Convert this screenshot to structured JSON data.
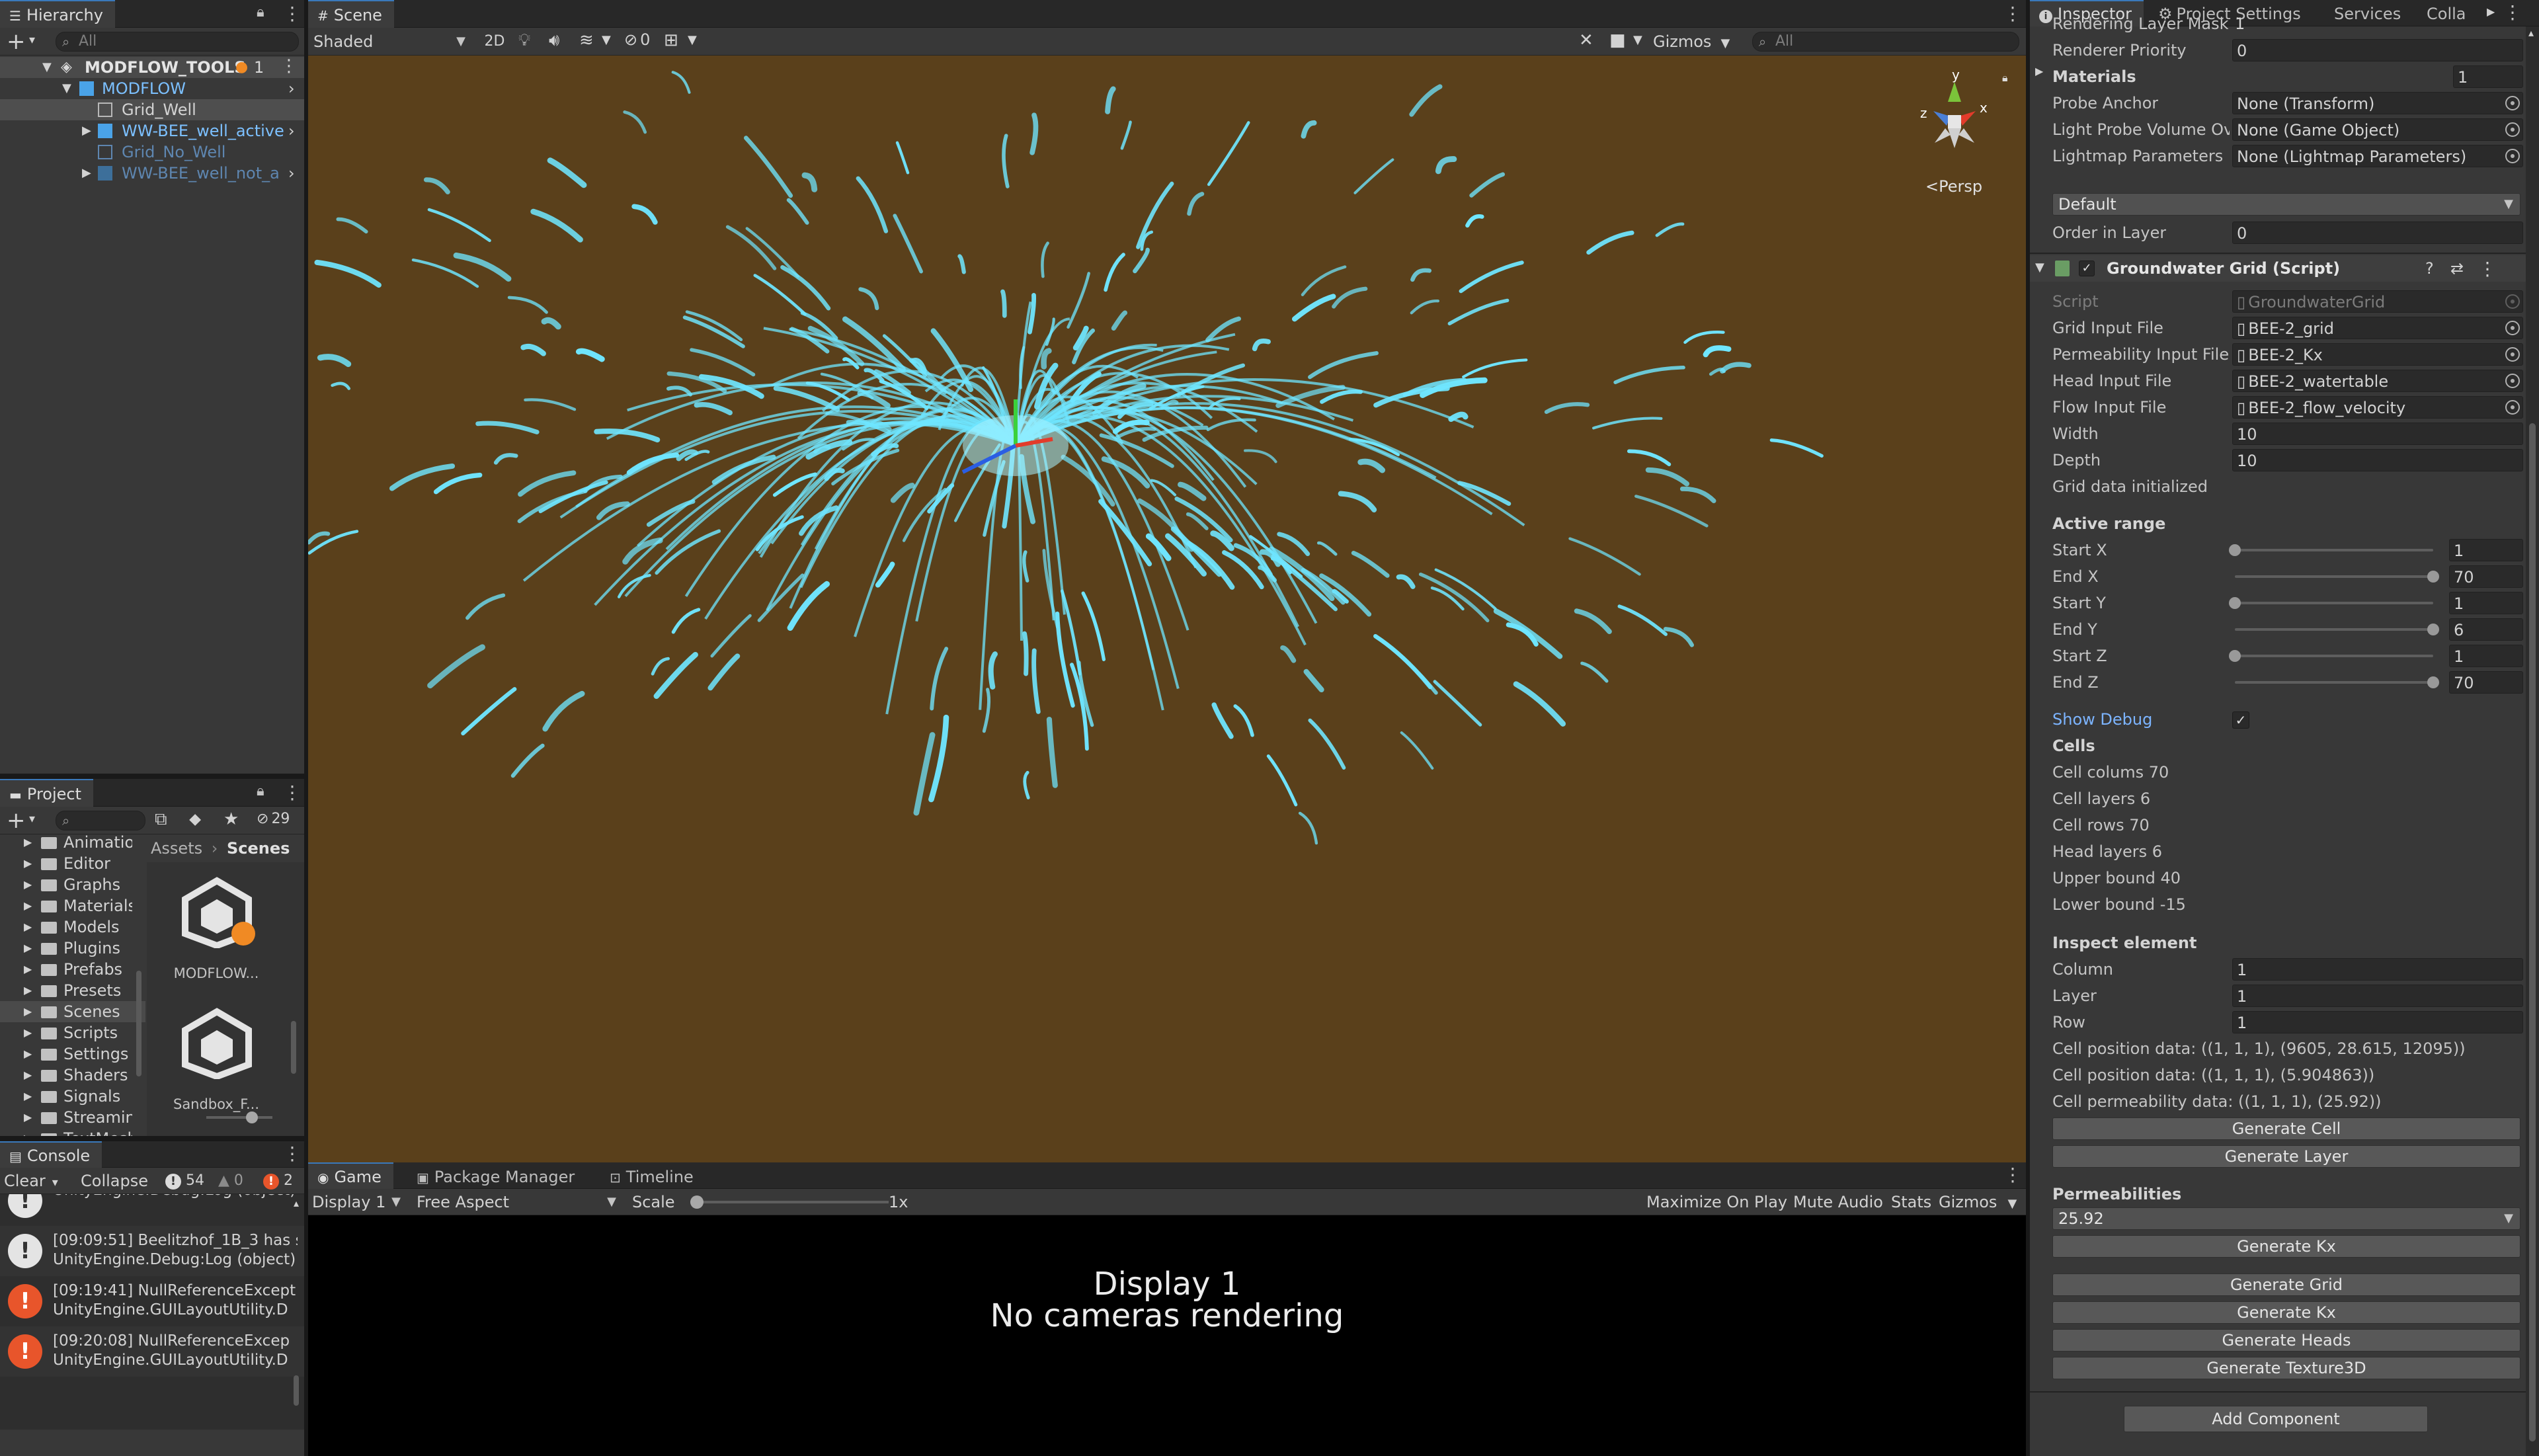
{
  "hierarchy": {
    "tab": "Hierarchy",
    "search_placeholder": "All",
    "scene": "MODFLOW_TOOLS",
    "scene_badge": "1",
    "items": [
      {
        "label": "MODFLOW",
        "color": "#7cc0ff"
      },
      {
        "label": "Grid_Well",
        "color": "#d2d2d2"
      },
      {
        "label": "WW-BEE_well_active",
        "color": "#7cc0ff"
      },
      {
        "label": "Grid_No_Well",
        "color": "#5e86b0"
      },
      {
        "label": "WW-BEE_well_not_active",
        "color": "#5e86b0"
      }
    ]
  },
  "scene": {
    "tab": "Scene",
    "shading": "Shaded",
    "btn_2d": "2D",
    "hidden_count": "0",
    "gizmos": "Gizmos",
    "search_placeholder": "All",
    "persp": "Persp",
    "axis_y": "y",
    "axis_x": "x",
    "axis_z": "z"
  },
  "project": {
    "tab": "Project",
    "count": "29",
    "breadcrumb": [
      "Assets",
      "Scenes"
    ],
    "folders": [
      "Animations",
      "Editor",
      "Graphs",
      "Materials",
      "Models",
      "Plugins",
      "Prefabs",
      "Presets",
      "Scenes",
      "Scripts",
      "Settings",
      "Shaders",
      "Signals",
      "StreamingAssets",
      "TextMeshPro"
    ],
    "assets": [
      {
        "label": "MODFLOW..."
      },
      {
        "label": "Sandbox_F..."
      }
    ]
  },
  "console": {
    "tab": "Console",
    "clear": "Clear",
    "collapse": "Collapse",
    "log_count": "54",
    "warn_count": "0",
    "err_count": "2",
    "rows": [
      {
        "line1": "",
        "line2": "UnityEngine.Debug:Log (object)",
        "type": "log"
      },
      {
        "line1": "[09:09:51] Beelitzhof_1B_3 has s",
        "line2": "UnityEngine.Debug:Log (object)",
        "type": "log"
      },
      {
        "line1": "[09:19:41] NullReferenceExcept",
        "line2": "UnityEngine.GUILayoutUtility.D",
        "type": "error"
      },
      {
        "line1": "[09:20:08] NullReferenceExcep",
        "line2": "UnityEngine.GUILayoutUtility.D",
        "type": "error"
      }
    ]
  },
  "game": {
    "tabs": [
      "Game",
      "Package Manager",
      "Timeline"
    ],
    "display": "Display 1",
    "aspect": "Free Aspect",
    "scale_label": "Scale",
    "scale_value": "1x",
    "toggles": [
      "Maximize On Play",
      "Mute Audio",
      "Stats",
      "Gizmos"
    ],
    "message_line1": "Display 1",
    "message_line2": "No cameras rendering"
  },
  "inspector": {
    "tabs": [
      "Inspector",
      "Project Settings",
      "Services",
      "Colla"
    ],
    "renderer": [
      {
        "label": "Rendering Layer Mask",
        "value": "1"
      },
      {
        "label": "Renderer Priority",
        "value": "0"
      }
    ],
    "materials_label": "Materials",
    "materials_count": "1",
    "probe": [
      {
        "label": "Probe Anchor",
        "value": "None (Transform)"
      },
      {
        "label": "Light Probe Volume Ove",
        "value": "None (Game Object)"
      },
      {
        "label": "Lightmap Parameters",
        "value": "None (Lightmap Parameters)"
      }
    ],
    "sorting_layer": "Default",
    "order_label": "Order in Layer",
    "order_value": "0",
    "component_title": "Groundwater Grid (Script)",
    "script_label": "Script",
    "script_value": "GroundwaterGrid",
    "files": [
      {
        "label": "Grid Input File",
        "value": "BEE-2_grid"
      },
      {
        "label": "Permeability Input File",
        "value": "BEE-2_Kx"
      },
      {
        "label": "Head Input File",
        "value": "BEE-2_watertable"
      },
      {
        "label": "Flow Input File",
        "value": "BEE-2_flow_velocity"
      }
    ],
    "width_label": "Width",
    "width_value": "10",
    "depth_label": "Depth",
    "depth_value": "10",
    "initialized": "Grid data initialized",
    "active_range_title": "Active range",
    "ranges": [
      {
        "label": "Start X",
        "value": "1",
        "frac": 0
      },
      {
        "label": "End X",
        "value": "70",
        "frac": 1
      },
      {
        "label": "Start Y",
        "value": "1",
        "frac": 0
      },
      {
        "label": "End Y",
        "value": "6",
        "frac": 1
      },
      {
        "label": "Start Z",
        "value": "1",
        "frac": 0
      },
      {
        "label": "End Z",
        "value": "70",
        "frac": 1
      }
    ],
    "show_debug": "Show Debug",
    "cells_title": "Cells",
    "cells": [
      "Cell colums 70",
      "Cell layers 6",
      "Cell rows 70",
      "Head layers 6",
      "Upper bound 40",
      "Lower bound -15"
    ],
    "inspect_title": "Inspect element",
    "inspect": [
      {
        "label": "Column",
        "value": "1"
      },
      {
        "label": "Layer",
        "value": "1"
      },
      {
        "label": "Row",
        "value": "1"
      }
    ],
    "info": [
      "Cell position data: ((1, 1, 1), (9605, 28.615, 12095))",
      "Cell position data: ((1, 1, 1), (5.904863))",
      "Cell permeability data: ((1, 1, 1), (25.92))"
    ],
    "btn_generate_cell": "Generate Cell",
    "btn_generate_layer": "Generate Layer",
    "permeabilities_title": "Permeabilities",
    "permeability_value": "25.92",
    "btn_generate_kx_1": "Generate Kx",
    "btn_generate_grid": "Generate Grid",
    "btn_generate_kx_2": "Generate Kx",
    "btn_generate_heads": "Generate Heads",
    "btn_generate_texture": "Generate Texture3D",
    "btn_add_component": "Add Component"
  },
  "colors": {
    "scene_bg": "#5a401b",
    "streamline": "#6fe6ff",
    "accent": "#3a79bb",
    "error": "#e8552b"
  }
}
